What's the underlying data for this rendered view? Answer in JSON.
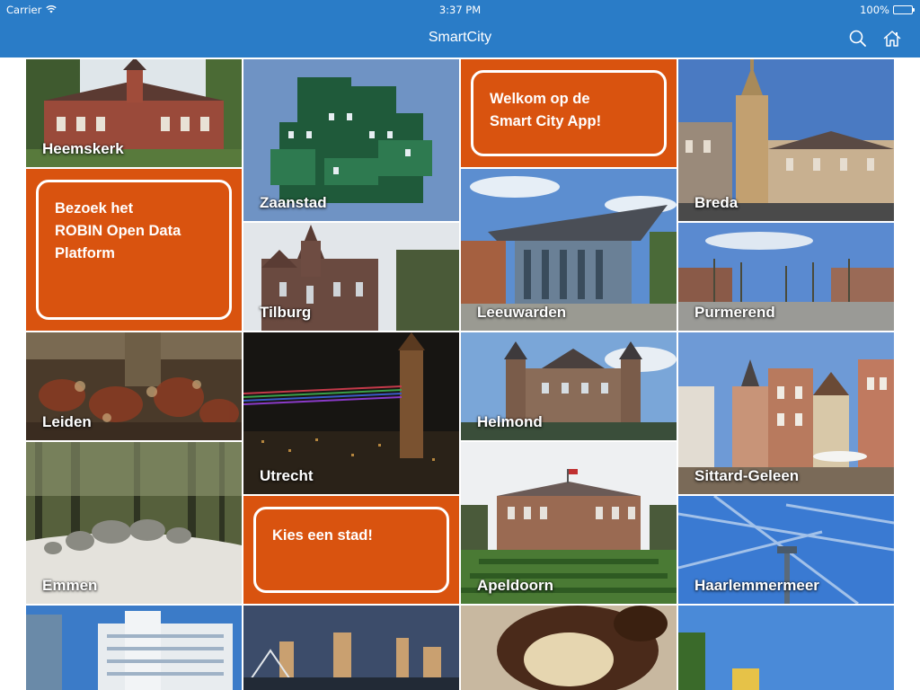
{
  "status_bar": {
    "carrier": "Carrier",
    "time": "3:37 PM",
    "battery": "100%"
  },
  "nav_bar": {
    "title": "SmartCity",
    "search_icon": "search-icon",
    "home_icon": "home-icon"
  },
  "colors": {
    "bar": "#2a7cc7",
    "promo": "#d9530f",
    "label": "#ffffff"
  },
  "tiles": {
    "heemskerk": "Heemskerk",
    "zaanstad": "Zaanstad",
    "breda": "Breda",
    "tilburg": "Tilburg",
    "leeuwarden": "Leeuwarden",
    "purmerend": "Purmerend",
    "leiden": "Leiden",
    "utrecht": "Utrecht",
    "helmond": "Helmond",
    "sittard": "Sittard-Geleen",
    "emmen": "Emmen",
    "apeldoorn": "Apeldoorn",
    "haarlemmermeer": "Haarlemmermeer"
  },
  "promos": {
    "welcome": "Welkom op de\nSmart City App!",
    "robin": "Bezoek het\nROBIN Open Data\nPlatform",
    "choose": "Kies een stad!"
  }
}
